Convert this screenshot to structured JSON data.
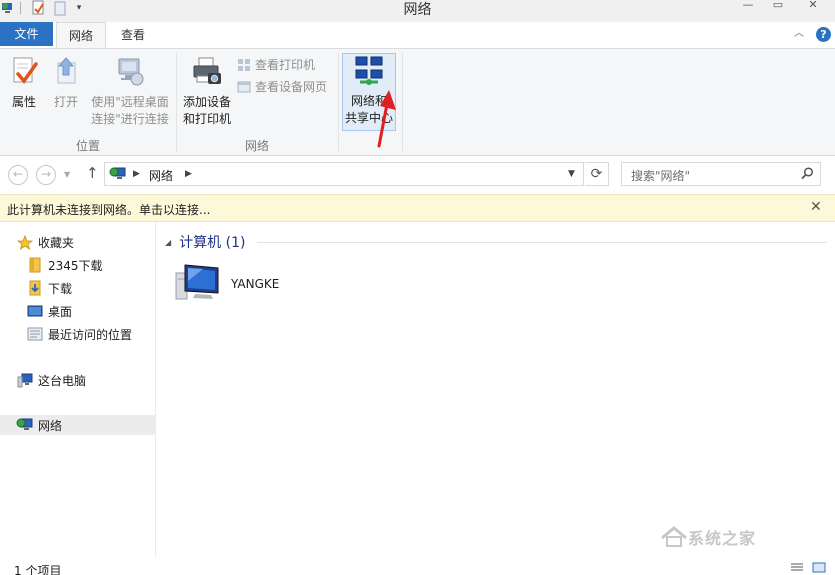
{
  "window": {
    "title": "网络"
  },
  "ribbon_tabs": {
    "file": "文件",
    "network": "网络",
    "view": "查看"
  },
  "ribbon": {
    "location_group": {
      "label": "位置",
      "properties": "属性",
      "open": "打开",
      "remote_line1": "使用\"远程桌面",
      "remote_line2": "连接\"进行连接"
    },
    "network_group": {
      "label": "网络",
      "add_device_line1": "添加设备",
      "add_device_line2": "和打印机",
      "view_printers": "查看打印机",
      "view_device_webpage": "查看设备网页"
    },
    "sharing_center": {
      "line1": "网络和",
      "line2": "共享中心"
    }
  },
  "address_bar": {
    "path": "网络",
    "search_placeholder": "搜索\"网络\""
  },
  "info_bar": {
    "message": "此计算机未连接到网络。单击以连接..."
  },
  "nav_pane": {
    "favorites": "收藏夹",
    "items": [
      "2345下载",
      "下载",
      "桌面",
      "最近访问的位置"
    ],
    "this_pc": "这台电脑",
    "network": "网络"
  },
  "content": {
    "group_header": "计算机 (1)",
    "items": [
      {
        "name": "YANGKE"
      }
    ]
  },
  "status_bar": {
    "item_count": "1 个项目"
  },
  "watermark": {
    "text": "系统之家"
  },
  "colors": {
    "file_tab": "#2b73c2",
    "group_header": "#1e3287",
    "info_bar_bg": "#fdf9d8",
    "annotation_arrow": "#e02020"
  },
  "icons": {
    "ribbon_properties": "properties-check-icon",
    "ribbon_open": "open-arrow-icon",
    "ribbon_remote_desktop": "remote-desktop-icon",
    "ribbon_add_device": "printer-camera-icon",
    "ribbon_sharing_center": "network-sharing-icon",
    "nav_favorites": "star-icon",
    "nav_folder": "folder-icon",
    "nav_network": "globe-monitor-icon",
    "content_computer": "computer-icon"
  }
}
